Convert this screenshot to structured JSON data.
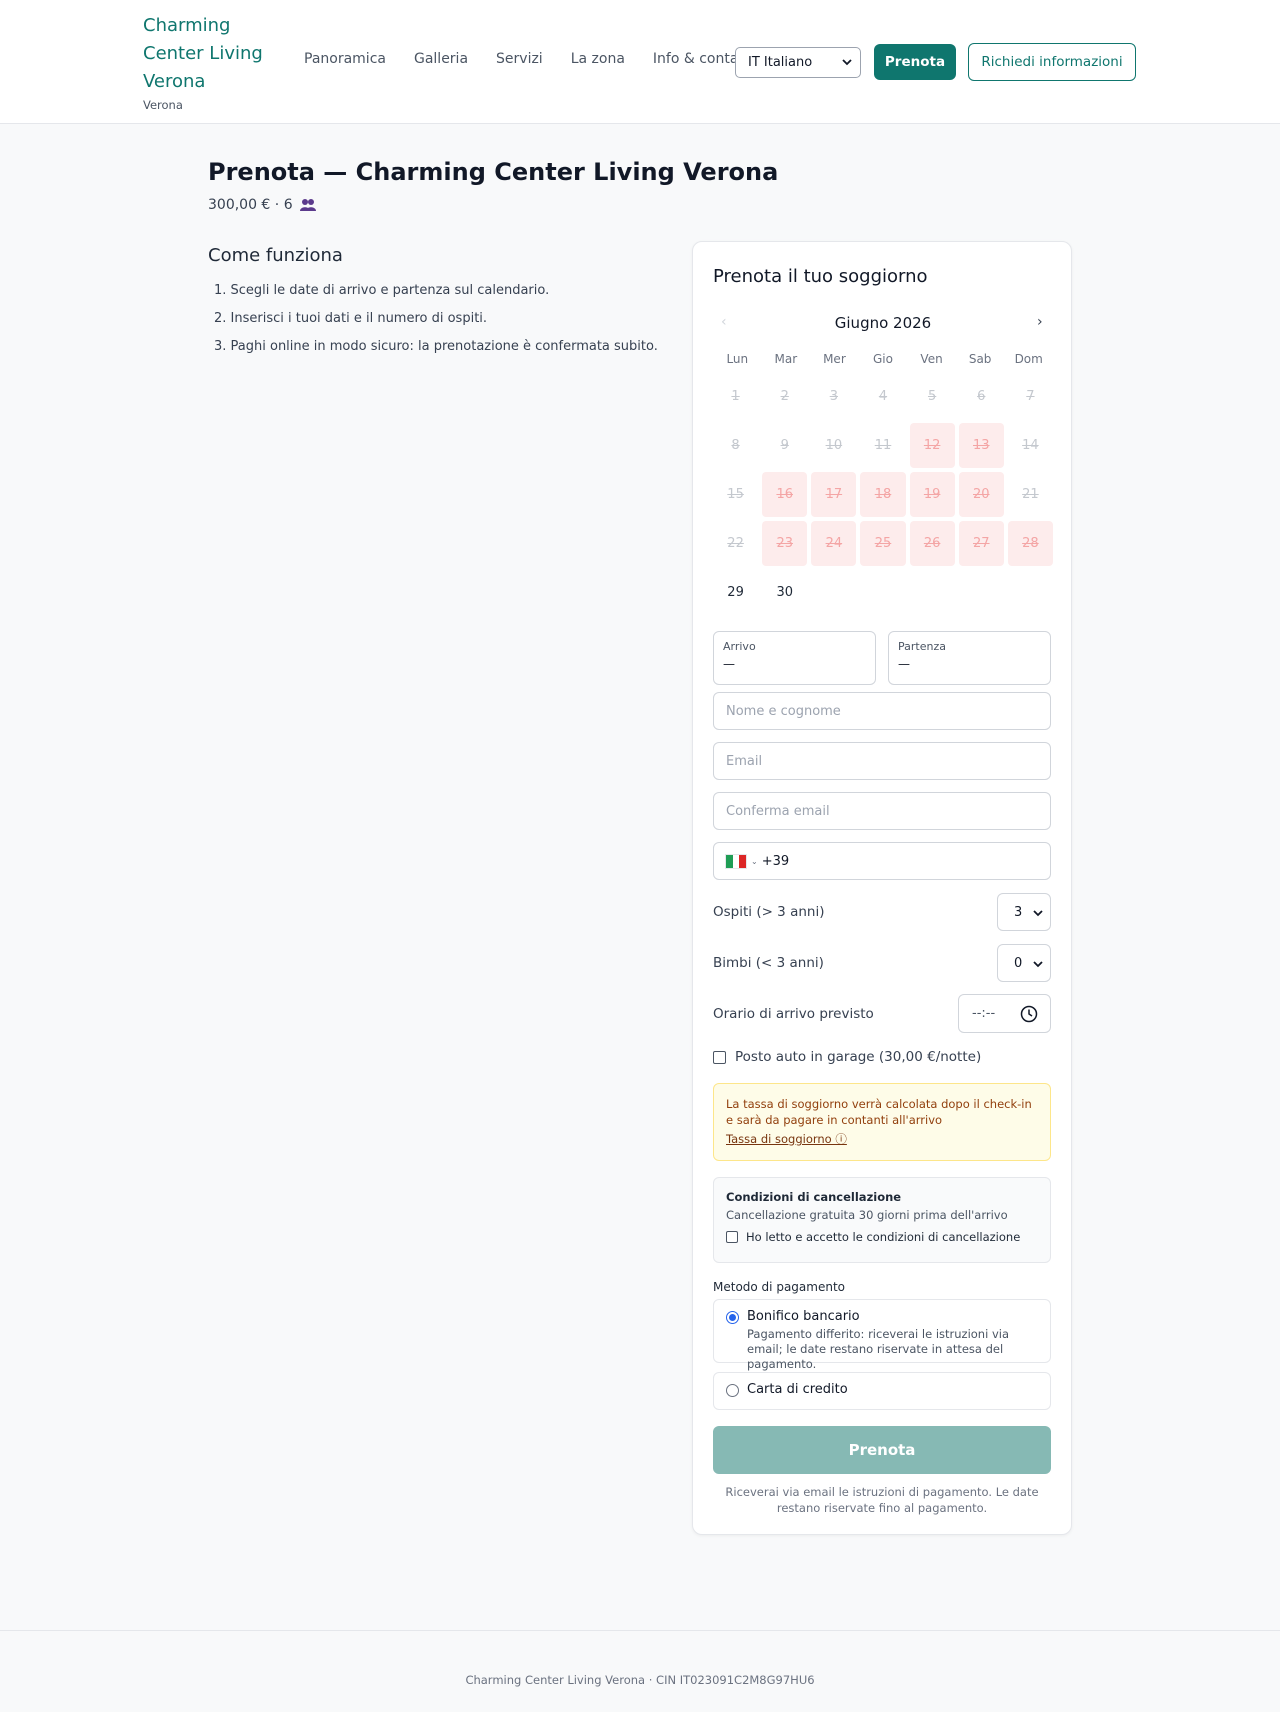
{
  "header": {
    "brand_name": "Charming Center Living Verona",
    "brand_city": "Verona",
    "nav": [
      "Panoramica",
      "Galleria",
      "Servizi",
      "La zona",
      "Info & contatti"
    ],
    "language": "IT Italiano",
    "book_button": "Prenota",
    "info_button": "Richiedi informazioni"
  },
  "page": {
    "title": "Prenota — Charming Center Living Verona",
    "subtitle": "300,00 € · 6"
  },
  "how_it_works": {
    "title": "Come funziona",
    "steps": [
      "1. Scegli le date di arrivo e partenza sul calendario.",
      "2. Inserisci i tuoi dati e il numero di ospiti.",
      "3. Paghi online in modo sicuro: la prenotazione è confermata subito."
    ]
  },
  "booking": {
    "title": "Prenota il tuo soggiorno",
    "calendar": {
      "prev": "‹",
      "next": "›",
      "month": "Giugno 2026",
      "weekdays": [
        "Lun",
        "Mar",
        "Mer",
        "Gio",
        "Ven",
        "Sab",
        "Dom"
      ],
      "days": [
        {
          "n": "1",
          "state": "past"
        },
        {
          "n": "2",
          "state": "past"
        },
        {
          "n": "3",
          "state": "past"
        },
        {
          "n": "4",
          "state": "past"
        },
        {
          "n": "5",
          "state": "past"
        },
        {
          "n": "6",
          "state": "past"
        },
        {
          "n": "7",
          "state": "past"
        },
        {
          "n": "8",
          "state": "past"
        },
        {
          "n": "9",
          "state": "past"
        },
        {
          "n": "10",
          "state": "past"
        },
        {
          "n": "11",
          "state": "past"
        },
        {
          "n": "12",
          "state": "booked"
        },
        {
          "n": "13",
          "state": "booked"
        },
        {
          "n": "14",
          "state": "past"
        },
        {
          "n": "15",
          "state": "past"
        },
        {
          "n": "16",
          "state": "booked"
        },
        {
          "n": "17",
          "state": "booked"
        },
        {
          "n": "18",
          "state": "booked"
        },
        {
          "n": "19",
          "state": "booked"
        },
        {
          "n": "20",
          "state": "booked"
        },
        {
          "n": "21",
          "state": "past"
        },
        {
          "n": "22",
          "state": "past"
        },
        {
          "n": "23",
          "state": "booked"
        },
        {
          "n": "24",
          "state": "booked"
        },
        {
          "n": "25",
          "state": "booked"
        },
        {
          "n": "26",
          "state": "booked"
        },
        {
          "n": "27",
          "state": "booked"
        },
        {
          "n": "28",
          "state": "booked"
        },
        {
          "n": "29",
          "state": "free"
        },
        {
          "n": "30",
          "state": "free"
        }
      ]
    },
    "arrival_label": "Arrivo",
    "arrival_value": "—",
    "departure_label": "Partenza",
    "departure_value": "—",
    "name_placeholder": "Nome e cognome",
    "email_placeholder": "Email",
    "confirm_email_placeholder": "Conferma email",
    "phone_code": "+39",
    "guests_label": "Ospiti (> 3 anni)",
    "guests_value": "3",
    "kids_label": "Bimbi (< 3 anni)",
    "kids_value": "0",
    "arrival_time_label": "Orario di arrivo previsto",
    "arrival_time_value": "--:--",
    "parking_label": "Posto auto in garage (30,00 €/notte)",
    "tax_notice": "La tassa di soggiorno verrà calcolata dopo il check-in e sarà da pagare in contanti all'arrivo",
    "tax_link": "Tassa di soggiorno ⓘ",
    "cancel_title": "Condizioni di cancellazione",
    "cancel_desc": "Cancellazione gratuita 30 giorni prima dell'arrivo",
    "cancel_accept": "Ho letto e accetto le condizioni di cancellazione",
    "payment_label": "Metodo di pagamento",
    "payment_bank_title": "Bonifico bancario",
    "payment_bank_desc": "Pagamento differito: riceverai le istruzioni via email; le date restano riservate in attesa del pagamento.",
    "payment_card_title": "Carta di credito",
    "submit": "Prenota",
    "footnote": "Riceverai via email le istruzioni di pagamento. Le date restano riservate fino al pagamento."
  },
  "footer": {
    "text": "Charming Center Living Verona · CIN IT023091C2M8G97HU6"
  },
  "colors": {
    "brand": "#0f766e",
    "booked_bg": "#fdecec",
    "notice_bg": "#fefce8"
  }
}
